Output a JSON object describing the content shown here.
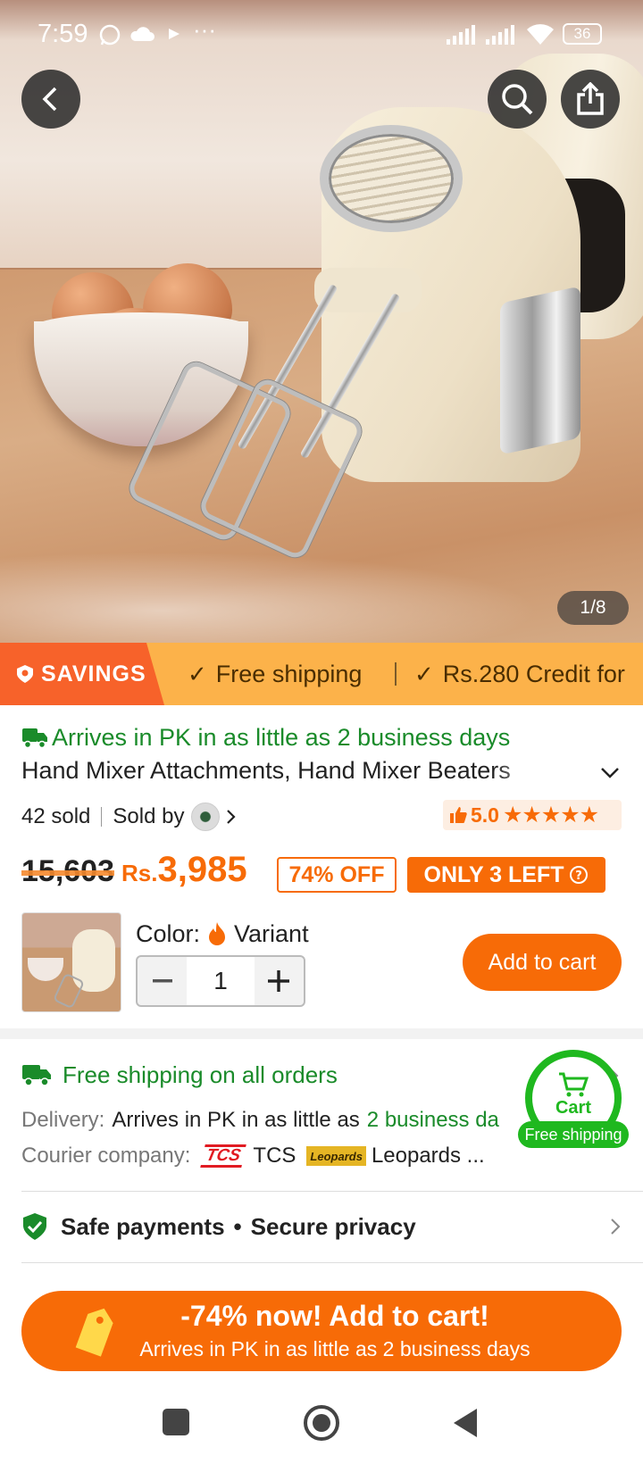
{
  "status_bar": {
    "time": "7:59",
    "battery": "36"
  },
  "gallery": {
    "counter": "1/8"
  },
  "strip": {
    "savings_label": "SAVINGS",
    "items": [
      "Free shipping",
      "Rs.280 Credit for"
    ]
  },
  "product": {
    "arrival": "Arrives in PK in as little as 2 business days",
    "title": "Hand Mixer Attachments, Hand Mixer Beaters",
    "sold": "42 sold",
    "sold_by": "Sold by",
    "rating": "5.0",
    "original_price": "15,603",
    "currency": "Rs.",
    "price": "3,985",
    "discount": "74% OFF",
    "stock": "ONLY 3 LEFT",
    "color_label": "Color:",
    "variant": "Variant",
    "quantity": "1",
    "add_to_cart": "Add to cart"
  },
  "shipping": {
    "headline": "Free shipping on all orders",
    "delivery_label": "Delivery:",
    "delivery_text": "Arrives in PK in as little as",
    "delivery_highlight": "2 business da",
    "courier_label": "Courier company:",
    "courier_1": "TCS",
    "courier_2": "Leopards ...",
    "tcs_logo": "TCS",
    "leopards_logo": "Leopards"
  },
  "cart_fab": {
    "label": "Cart",
    "badge": "Free shipping"
  },
  "payments": {
    "safe": "Safe payments",
    "secure": "Secure privacy"
  },
  "cta": {
    "title": "-74% now! Add to cart!",
    "subtitle": "Arrives in PK in as little as 2 business days"
  },
  "colors": {
    "accent": "#f76b07",
    "green": "#1a8b2a",
    "savings_red": "#f7622a",
    "strip_yellow": "#fcb24a"
  }
}
